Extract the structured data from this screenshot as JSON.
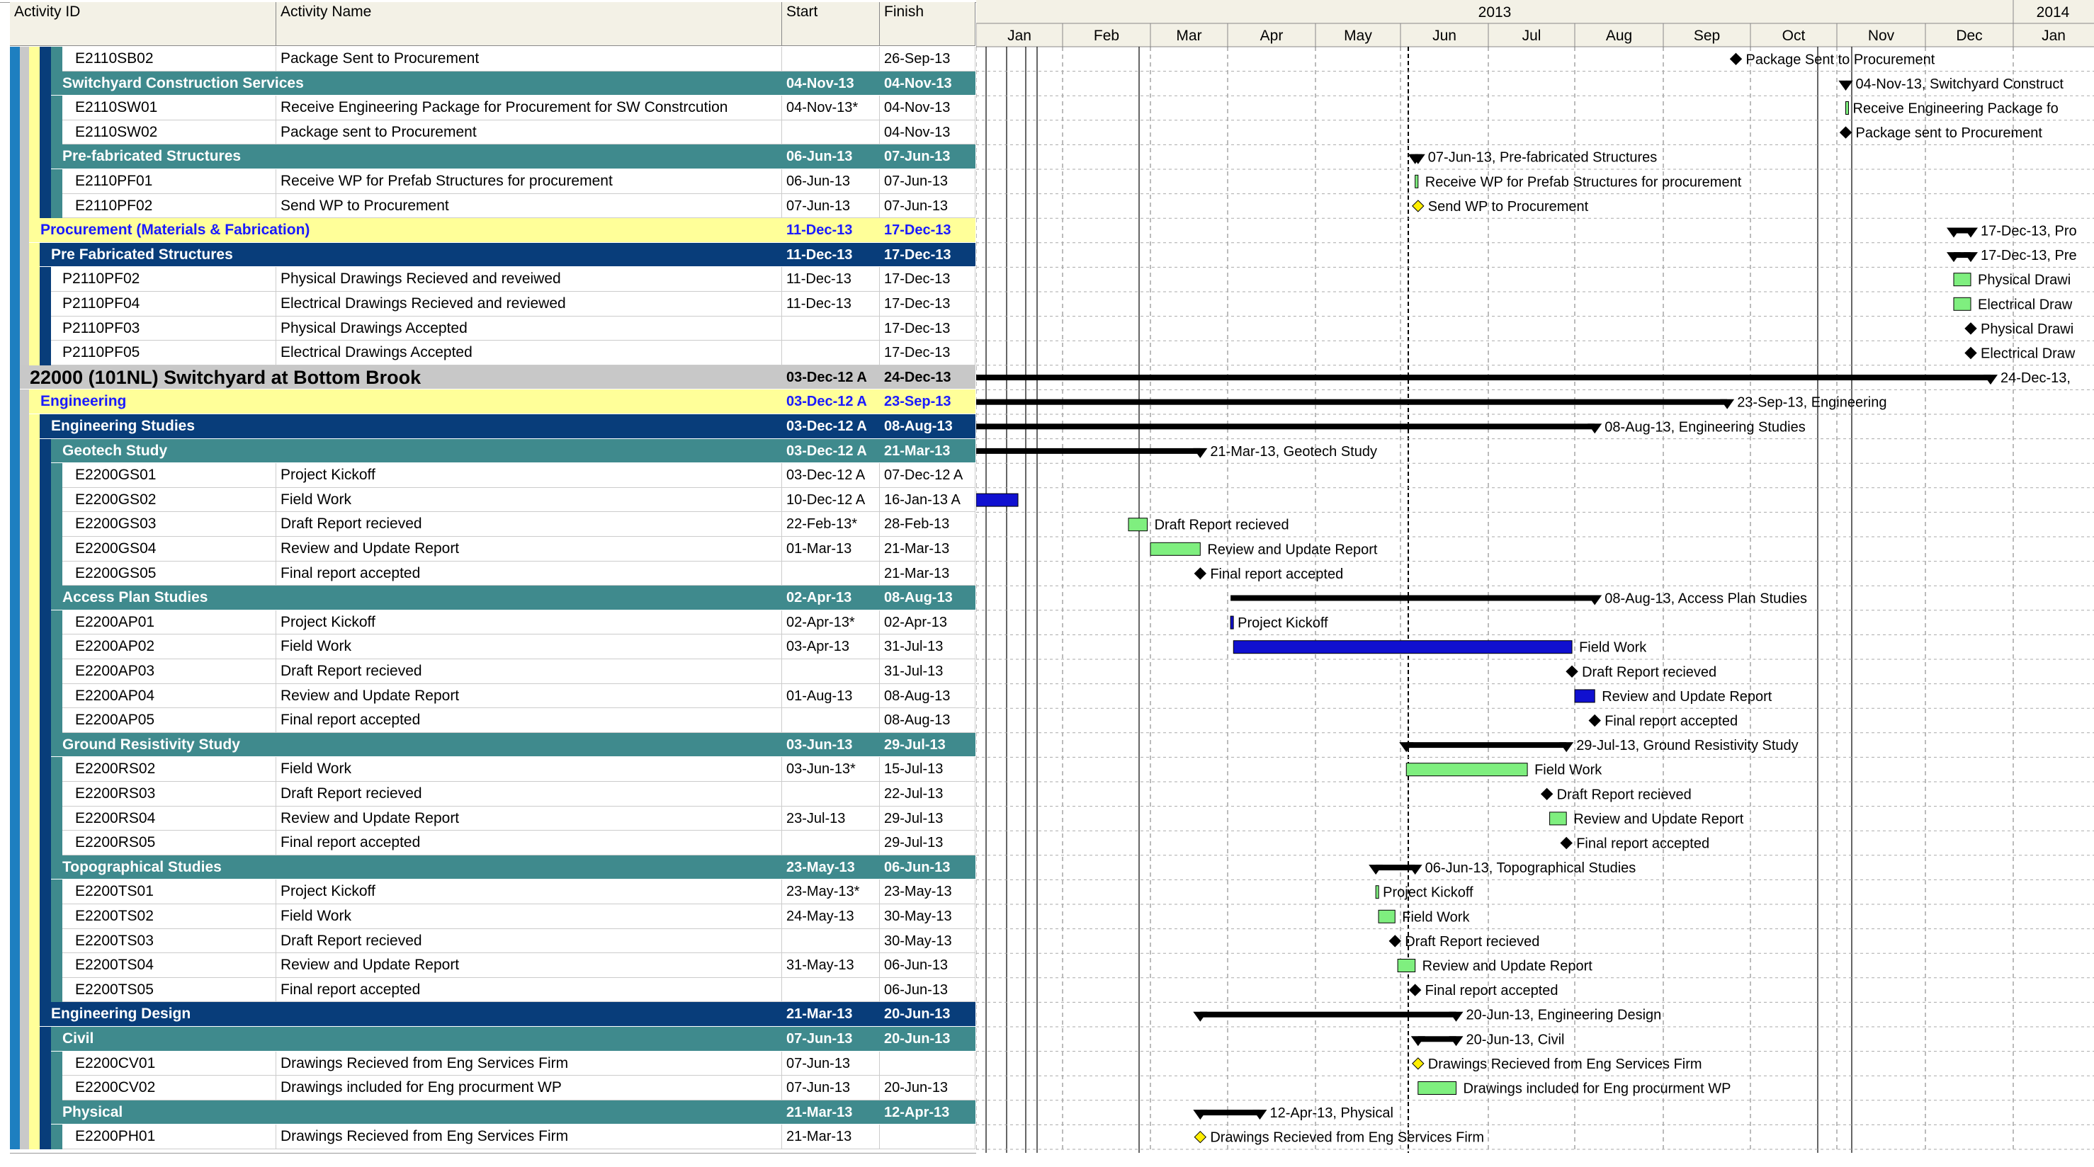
{
  "columns": {
    "id": "Activity ID",
    "name": "Activity Name",
    "start": "Start",
    "finish": "Finish"
  },
  "timeline": {
    "years": [
      {
        "label": "2013"
      },
      {
        "label": "2014"
      }
    ],
    "months": [
      "Jan",
      "Feb",
      "Mar",
      "Apr",
      "May",
      "Jun",
      "Jul",
      "Aug",
      "Sep",
      "Oct",
      "Nov",
      "Dec",
      "Jan"
    ]
  },
  "colors": {
    "teal": "#3f8a8d",
    "navy": "#083d7a",
    "yellow": "#ffff99",
    "gray": "#c8c8c8",
    "bar_green": "#7fef7f",
    "bar_blue": "#1010d0",
    "milestone_yellow": "#ffee00"
  },
  "rows": [
    {
      "kind": "act",
      "indent": 3,
      "id": "E2110SB02",
      "name": "Package Sent to Procurement",
      "start": "",
      "finish": "26-Sep-13",
      "label": "Package Sent to Procurement"
    },
    {
      "kind": "teal",
      "indent": 2,
      "id": "",
      "name": "Switchyard Construction Services",
      "start": "04-Nov-13",
      "finish": "04-Nov-13",
      "label": "04-Nov-13, Switchyard Construct"
    },
    {
      "kind": "act",
      "indent": 3,
      "id": "E2110SW01",
      "name": "Receive Engineering Package for Procurement for SW Constrcution",
      "start": "04-Nov-13*",
      "finish": "04-Nov-13",
      "label": "Receive Engineering Package fo"
    },
    {
      "kind": "act",
      "indent": 3,
      "id": "E2110SW02",
      "name": "Package sent to Procurement",
      "start": "",
      "finish": "04-Nov-13",
      "label": "Package sent to Procurement"
    },
    {
      "kind": "teal",
      "indent": 2,
      "id": "",
      "name": "Pre-fabricated Structures",
      "start": "06-Jun-13",
      "finish": "07-Jun-13",
      "label": "07-Jun-13, Pre-fabricated Structures"
    },
    {
      "kind": "act",
      "indent": 3,
      "id": "E2110PF01",
      "name": "Receive WP for Prefab Structures for procurement",
      "start": "06-Jun-13",
      "finish": "07-Jun-13",
      "label": "Receive WP for Prefab Structures for procurement"
    },
    {
      "kind": "act",
      "indent": 3,
      "id": "E2110PF02",
      "name": "Send WP to Procurement",
      "start": "07-Jun-13",
      "finish": "07-Jun-13",
      "label": "Send WP to Procurement"
    },
    {
      "kind": "yellow",
      "indent": 0,
      "id": "",
      "name": "Procurement (Materials & Fabrication)",
      "start": "11-Dec-13",
      "finish": "17-Dec-13",
      "label": "17-Dec-13, Pro"
    },
    {
      "kind": "navy",
      "indent": 1,
      "id": "",
      "name": "Pre Fabricated Structures",
      "start": "11-Dec-13",
      "finish": "17-Dec-13",
      "label": "17-Dec-13, Pre"
    },
    {
      "kind": "act",
      "indent": 2,
      "id": "P2110PF02",
      "name": "Physical Drawings Recieved and reveiwed",
      "start": "11-Dec-13",
      "finish": "17-Dec-13",
      "label": "Physical Drawi"
    },
    {
      "kind": "act",
      "indent": 2,
      "id": "P2110PF04",
      "name": "Electrical Drawings Recieved and reviewed",
      "start": "11-Dec-13",
      "finish": "17-Dec-13",
      "label": "Electrical Draw"
    },
    {
      "kind": "act",
      "indent": 2,
      "id": "P2110PF03",
      "name": "Physical Drawings Accepted",
      "start": "",
      "finish": "17-Dec-13",
      "label": "Physical Drawi"
    },
    {
      "kind": "act",
      "indent": 2,
      "id": "P2110PF05",
      "name": "Electrical Drawings Accepted",
      "start": "",
      "finish": "17-Dec-13",
      "label": "Electrical Draw"
    },
    {
      "kind": "gray",
      "indent": -1,
      "id": "",
      "name": "22000 (101NL) Switchyard at Bottom Brook",
      "start": "03-Dec-12 A",
      "finish": "24-Dec-13",
      "label": "24-Dec-13,"
    },
    {
      "kind": "yellow",
      "indent": 0,
      "id": "",
      "name": "Engineering",
      "start": "03-Dec-12 A",
      "finish": "23-Sep-13",
      "label": "23-Sep-13, Engineering"
    },
    {
      "kind": "navy",
      "indent": 1,
      "id": "",
      "name": "Engineering Studies",
      "start": "03-Dec-12 A",
      "finish": "08-Aug-13",
      "label": "08-Aug-13, Engineering Studies"
    },
    {
      "kind": "teal",
      "indent": 2,
      "id": "",
      "name": "Geotech Study",
      "start": "03-Dec-12 A",
      "finish": "21-Mar-13",
      "label": "21-Mar-13, Geotech Study"
    },
    {
      "kind": "act",
      "indent": 3,
      "id": "E2200GS01",
      "name": "Project Kickoff",
      "start": "03-Dec-12 A",
      "finish": "07-Dec-12 A",
      "label": ""
    },
    {
      "kind": "act",
      "indent": 3,
      "id": "E2200GS02",
      "name": "Field Work",
      "start": "10-Dec-12 A",
      "finish": "16-Jan-13 A",
      "label": ""
    },
    {
      "kind": "act",
      "indent": 3,
      "id": "E2200GS03",
      "name": "Draft Report recieved",
      "start": "22-Feb-13*",
      "finish": "28-Feb-13",
      "label": "Draft Report recieved"
    },
    {
      "kind": "act",
      "indent": 3,
      "id": "E2200GS04",
      "name": "Review and Update Report",
      "start": "01-Mar-13",
      "finish": "21-Mar-13",
      "label": "Review and Update Report"
    },
    {
      "kind": "act",
      "indent": 3,
      "id": "E2200GS05",
      "name": "Final report accepted",
      "start": "",
      "finish": "21-Mar-13",
      "label": "Final report accepted"
    },
    {
      "kind": "teal",
      "indent": 2,
      "id": "",
      "name": "Access Plan Studies",
      "start": "02-Apr-13",
      "finish": "08-Aug-13",
      "label": "08-Aug-13, Access Plan Studies"
    },
    {
      "kind": "act",
      "indent": 3,
      "id": "E2200AP01",
      "name": "Project Kickoff",
      "start": "02-Apr-13*",
      "finish": "02-Apr-13",
      "label": "Project Kickoff"
    },
    {
      "kind": "act",
      "indent": 3,
      "id": "E2200AP02",
      "name": "Field Work",
      "start": "03-Apr-13",
      "finish": "31-Jul-13",
      "label": "Field Work"
    },
    {
      "kind": "act",
      "indent": 3,
      "id": "E2200AP03",
      "name": "Draft Report recieved",
      "start": "",
      "finish": "31-Jul-13",
      "label": "Draft Report recieved"
    },
    {
      "kind": "act",
      "indent": 3,
      "id": "E2200AP04",
      "name": "Review and Update Report",
      "start": "01-Aug-13",
      "finish": "08-Aug-13",
      "label": "Review and Update Report"
    },
    {
      "kind": "act",
      "indent": 3,
      "id": "E2200AP05",
      "name": "Final report accepted",
      "start": "",
      "finish": "08-Aug-13",
      "label": "Final report accepted"
    },
    {
      "kind": "teal",
      "indent": 2,
      "id": "",
      "name": "Ground Resistivity Study",
      "start": "03-Jun-13",
      "finish": "29-Jul-13",
      "label": "29-Jul-13, Ground Resistivity Study"
    },
    {
      "kind": "act",
      "indent": 3,
      "id": "E2200RS02",
      "name": "Field Work",
      "start": "03-Jun-13*",
      "finish": "15-Jul-13",
      "label": "Field Work"
    },
    {
      "kind": "act",
      "indent": 3,
      "id": "E2200RS03",
      "name": "Draft Report recieved",
      "start": "",
      "finish": "22-Jul-13",
      "label": "Draft Report recieved"
    },
    {
      "kind": "act",
      "indent": 3,
      "id": "E2200RS04",
      "name": "Review and Update Report",
      "start": "23-Jul-13",
      "finish": "29-Jul-13",
      "label": "Review and Update Report"
    },
    {
      "kind": "act",
      "indent": 3,
      "id": "E2200RS05",
      "name": "Final report accepted",
      "start": "",
      "finish": "29-Jul-13",
      "label": "Final report accepted"
    },
    {
      "kind": "teal",
      "indent": 2,
      "id": "",
      "name": "Topographical Studies",
      "start": "23-May-13",
      "finish": "06-Jun-13",
      "label": "06-Jun-13, Topographical Studies"
    },
    {
      "kind": "act",
      "indent": 3,
      "id": "E2200TS01",
      "name": "Project Kickoff",
      "start": "23-May-13*",
      "finish": "23-May-13",
      "label": "Project Kickoff"
    },
    {
      "kind": "act",
      "indent": 3,
      "id": "E2200TS02",
      "name": "Field Work",
      "start": "24-May-13",
      "finish": "30-May-13",
      "label": "Field Work"
    },
    {
      "kind": "act",
      "indent": 3,
      "id": "E2200TS03",
      "name": "Draft Report recieved",
      "start": "",
      "finish": "30-May-13",
      "label": "Draft Report recieved"
    },
    {
      "kind": "act",
      "indent": 3,
      "id": "E2200TS04",
      "name": "Review and Update Report",
      "start": "31-May-13",
      "finish": "06-Jun-13",
      "label": "Review and Update Report"
    },
    {
      "kind": "act",
      "indent": 3,
      "id": "E2200TS05",
      "name": "Final report accepted",
      "start": "",
      "finish": "06-Jun-13",
      "label": "Final report accepted"
    },
    {
      "kind": "navy",
      "indent": 1,
      "id": "",
      "name": "Engineering Design",
      "start": "21-Mar-13",
      "finish": "20-Jun-13",
      "label": "20-Jun-13, Engineering Design"
    },
    {
      "kind": "teal",
      "indent": 2,
      "id": "",
      "name": "Civil",
      "start": "07-Jun-13",
      "finish": "20-Jun-13",
      "label": "20-Jun-13, Civil"
    },
    {
      "kind": "act",
      "indent": 3,
      "id": "E2200CV01",
      "name": "Drawings Recieved from Eng Services Firm",
      "start": "07-Jun-13",
      "finish": "",
      "label": "Drawings Recieved from Eng Services Firm"
    },
    {
      "kind": "act",
      "indent": 3,
      "id": "E2200CV02",
      "name": "Drawings included for Eng procurment WP",
      "start": "07-Jun-13",
      "finish": "20-Jun-13",
      "label": "Drawings included for Eng procurment WP"
    },
    {
      "kind": "teal",
      "indent": 2,
      "id": "",
      "name": "Physical",
      "start": "21-Mar-13",
      "finish": "12-Apr-13",
      "label": "12-Apr-13, Physical"
    },
    {
      "kind": "act",
      "indent": 3,
      "id": "E2200PH01",
      "name": "Drawings Recieved  from Eng Services Firm",
      "start": "21-Mar-13",
      "finish": "",
      "label": "Drawings Recieved  from Eng Services Firm"
    }
  ]
}
